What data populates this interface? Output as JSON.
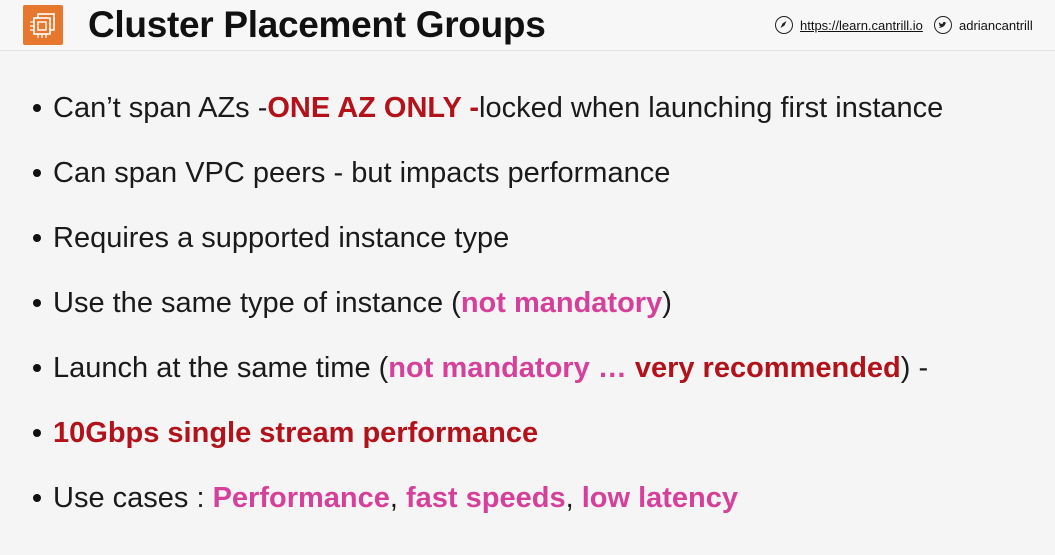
{
  "header": {
    "title": "Cluster Placement Groups",
    "site_link": "https://learn.cantrill.io",
    "social_handle": "adriancantrill",
    "logo_icon": "ec2-cluster-icon",
    "accent_color": "#e8772e"
  },
  "bullets": [
    {
      "parts": [
        "Can’t span AZs - ",
        "ONE AZ ONLY - ",
        "locked when launching first instance"
      ]
    },
    {
      "parts": [
        "Can span VPC peers - but impacts performance"
      ]
    },
    {
      "parts": [
        "Requires a supported instance type"
      ]
    },
    {
      "parts": [
        "Use the same type of instance (",
        "not mandatory",
        ")"
      ]
    },
    {
      "parts": [
        "Launch at the same time (",
        "not mandatory … ",
        "very recommended",
        ") -"
      ]
    },
    {
      "parts": [
        "10Gbps single stream performance"
      ]
    },
    {
      "parts": [
        "Use cases : ",
        "Performance",
        ", ",
        "fast speeds",
        ", ",
        "low latency"
      ]
    }
  ],
  "colors": {
    "emphasis_red": "#b3121a",
    "emphasis_pink": "#d6409a"
  }
}
